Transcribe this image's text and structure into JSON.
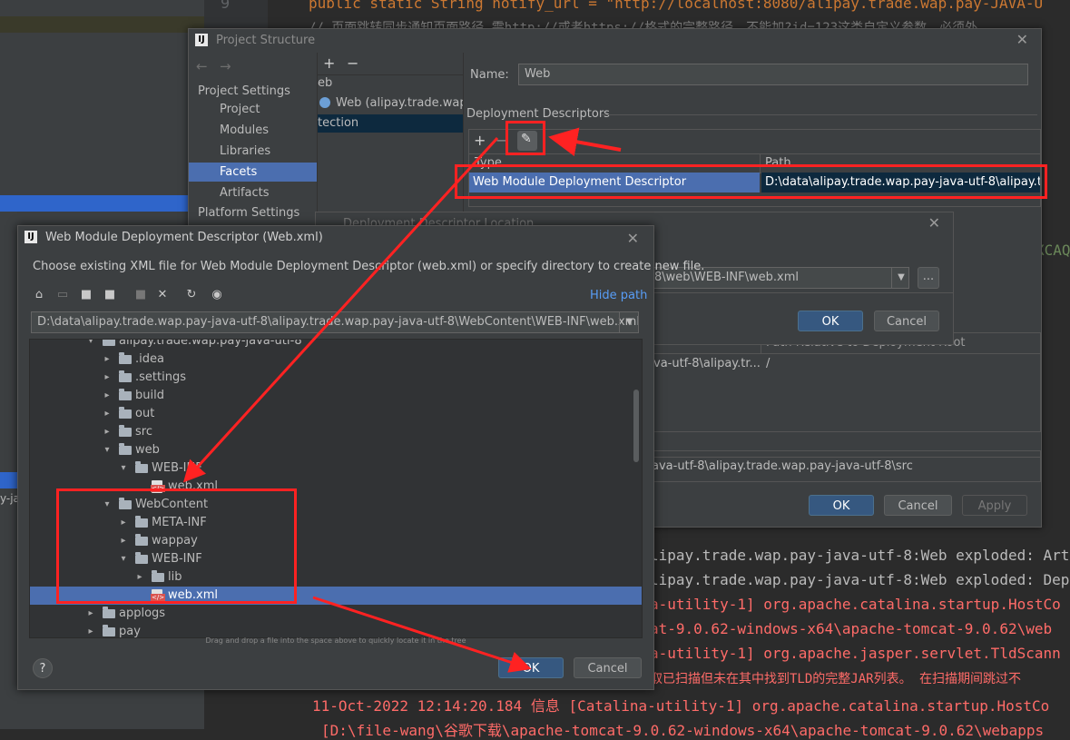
{
  "editor": {
    "line_number": "9",
    "code_line1": "public static String notify_url = \"http://localhost:8080/alipay.trade.wap.pay-JAVA-U",
    "code_line2": "// 页面跳转同步通知页面路径 需http://或者https://格式的完整路径，不能加?id=123这类自定义参数，必须外",
    "code_fragment_right": "XCAQ"
  },
  "console": {
    "lines": [
      "lipay.trade.wap.pay-java-utf-8:Web exploded: Art",
      "lipay.trade.wap.pay-java-utf-8:Web exploded: Dep",
      "a-utility-1] org.apache.catalina.startup.HostCo",
      "at-9.0.62-windows-x64\\apache-tomcat-9.0.62\\web",
      "a-utility-1] org.apache.jasper.servlet.TldScann",
      "取已扫描但未在其中找到TLD的完整JAR列表。 在扫描期间跳过不",
      "11-Oct-2022 12:14:20.184 信息 [Catalina-utility-1] org.apache.catalina.startup.HostCo",
      "[D:\\file-wang\\谷歌下载\\apache-tomcat-9.0.62-windows-x64\\apache-tomcat-9.0.62\\webapps"
    ],
    "left_fragment": "y-ja"
  },
  "project_structure": {
    "title": "Project Structure",
    "nav": {
      "project_settings_label": "Project Settings",
      "items": [
        "Project",
        "Modules",
        "Libraries",
        "Facets",
        "Artifacts"
      ],
      "selected": "Facets",
      "platform_settings_label": "Platform Settings"
    },
    "middle": {
      "add": "+",
      "remove": "−",
      "group_label": "eb",
      "facet_item": "Web (alipay.trade.wap.p",
      "detection_label": "tection"
    },
    "name_label": "Name:",
    "name_value": "Web",
    "deployment_descriptors_label": "Deployment Descriptors",
    "dd_table": {
      "headers": [
        "Type",
        "Path"
      ],
      "row": {
        "type": "Web Module Deployment Descriptor",
        "path": "D:\\data\\alipay.trade.wap.pay-java-utf-8\\alipay.trade.w"
      }
    },
    "web_roots_header": "Path Relative to Deployment Root",
    "web_root_row": {
      "dir": "va-utf-8\\alipay.tr...",
      "rel": "/"
    },
    "source_root_row": "ava-utf-8\\alipay.trade.wap.pay-java-utf-8\\src",
    "ok_label": "OK",
    "cancel_label": "Cancel",
    "apply_label": "Apply"
  },
  "descriptor_location": {
    "title": "Deployment Descriptor Location",
    "path_value": "y-java-utf-8\\web\\WEB-INF\\web.xml",
    "browse_label": "...",
    "ok_label": "OK",
    "cancel_label": "Cancel"
  },
  "web_module_dialog": {
    "title": "Web Module Deployment Descriptor (Web.xml)",
    "description": "Choose existing XML file for Web Module Deployment Descriptor (web.xml) or specify directory to create new file.",
    "hide_path_label": "Hide path",
    "path_value": "D:\\data\\alipay.trade.wap.pay-java-utf-8\\alipay.trade.wap.pay-java-utf-8\\WebContent\\WEB-INF\\web.xml",
    "tree": [
      {
        "label": "alipay.trade.wap.pay-java-utf-8",
        "level": 0,
        "expanded": true,
        "type": "folder"
      },
      {
        "label": ".idea",
        "level": 1,
        "expanded": false,
        "type": "folder"
      },
      {
        "label": ".settings",
        "level": 1,
        "expanded": false,
        "type": "folder"
      },
      {
        "label": "build",
        "level": 1,
        "expanded": false,
        "type": "folder"
      },
      {
        "label": "out",
        "level": 1,
        "expanded": false,
        "type": "folder"
      },
      {
        "label": "src",
        "level": 1,
        "expanded": false,
        "type": "folder"
      },
      {
        "label": "web",
        "level": 1,
        "expanded": true,
        "type": "folder"
      },
      {
        "label": "WEB-INF",
        "level": 2,
        "expanded": true,
        "type": "folder"
      },
      {
        "label": "web.xml",
        "level": 3,
        "type": "xml"
      },
      {
        "label": "WebContent",
        "level": 1,
        "expanded": true,
        "type": "folder"
      },
      {
        "label": "META-INF",
        "level": 2,
        "expanded": false,
        "type": "folder"
      },
      {
        "label": "wappay",
        "level": 2,
        "expanded": false,
        "type": "folder"
      },
      {
        "label": "WEB-INF",
        "level": 2,
        "expanded": true,
        "type": "folder"
      },
      {
        "label": "lib",
        "level": 3,
        "expanded": false,
        "type": "folder"
      },
      {
        "label": "web.xml",
        "level": 3,
        "type": "xml",
        "selected": true
      },
      {
        "label": "applogs",
        "level": 0,
        "expanded": false,
        "type": "folder"
      },
      {
        "label": "pay",
        "level": 0,
        "expanded": false,
        "type": "folder"
      }
    ],
    "drag_hint": "Drag and drop a file into the space above to quickly locate it in the tree",
    "help_label": "?",
    "ok_label": "OK",
    "cancel_label": "Cancel"
  },
  "colors": {
    "annotation_red": "#ff2222",
    "selection_blue": "#4b6eaf",
    "primary_button": "#365880",
    "dialog_bg": "#3c3f41"
  }
}
